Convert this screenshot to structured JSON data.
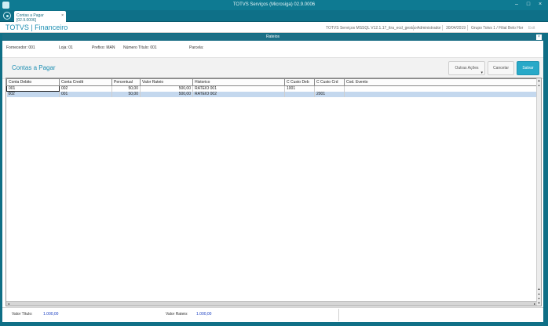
{
  "window": {
    "title": "TOTVS Serviços (Microsiga) 02.9.0006",
    "minimize": "–",
    "maximize": "□",
    "close": "×"
  },
  "tabs": [
    {
      "label": "Contas a Pagar [02.9.0006]",
      "close": "×"
    }
  ],
  "header": {
    "brand": "TOTVS | Financeiro",
    "environment": "TOTVS Serviços MSSQL V12.1.17_itra_ecd_gestao",
    "user": "Administrador",
    "date": "30/04/2019",
    "branch": "Grupo Totvs 1 / Filial Belo Hor",
    "exit_label": "Exit"
  },
  "dialog": {
    "title": "Rateios",
    "close": "×"
  },
  "meta": {
    "fornecedor": "Fornecedor: 001",
    "loja": "Loja: 01",
    "prefixo": "Prefixo: MAN",
    "numero_titulo": "Número Título: 001",
    "parcela": "Parcela:"
  },
  "actions": {
    "page_title": "Contas a Pagar",
    "outras_acoes": "Outras Ações",
    "cancelar": "Cancelar",
    "salvar": "Salvar"
  },
  "table": {
    "columns": [
      "Conta Debito",
      "Conta Credit",
      "Percentual",
      "Valor Rateio",
      "Historico",
      "C Custo Deb",
      "C Custo Crd",
      "Cod. Evento"
    ],
    "rows": [
      [
        "001",
        "002",
        "50,00",
        "500,00",
        "RATEIO 001",
        "1001",
        "",
        ""
      ],
      [
        "002",
        "001",
        "50,00",
        "500,00",
        "RATEIO 002",
        "",
        "2001",
        ""
      ]
    ]
  },
  "footer": {
    "valor_titulo_label": "Valor Título:",
    "valor_titulo": "1.000,00",
    "valor_rateio_label": "Valor Rateio:",
    "valor_rateio": "1.000,00"
  },
  "colors": {
    "accent": "#1d8fb3",
    "primary_button": "#28a9c8",
    "dialog_header": "#1c6f86",
    "selected_row": "#c4d8ee"
  }
}
